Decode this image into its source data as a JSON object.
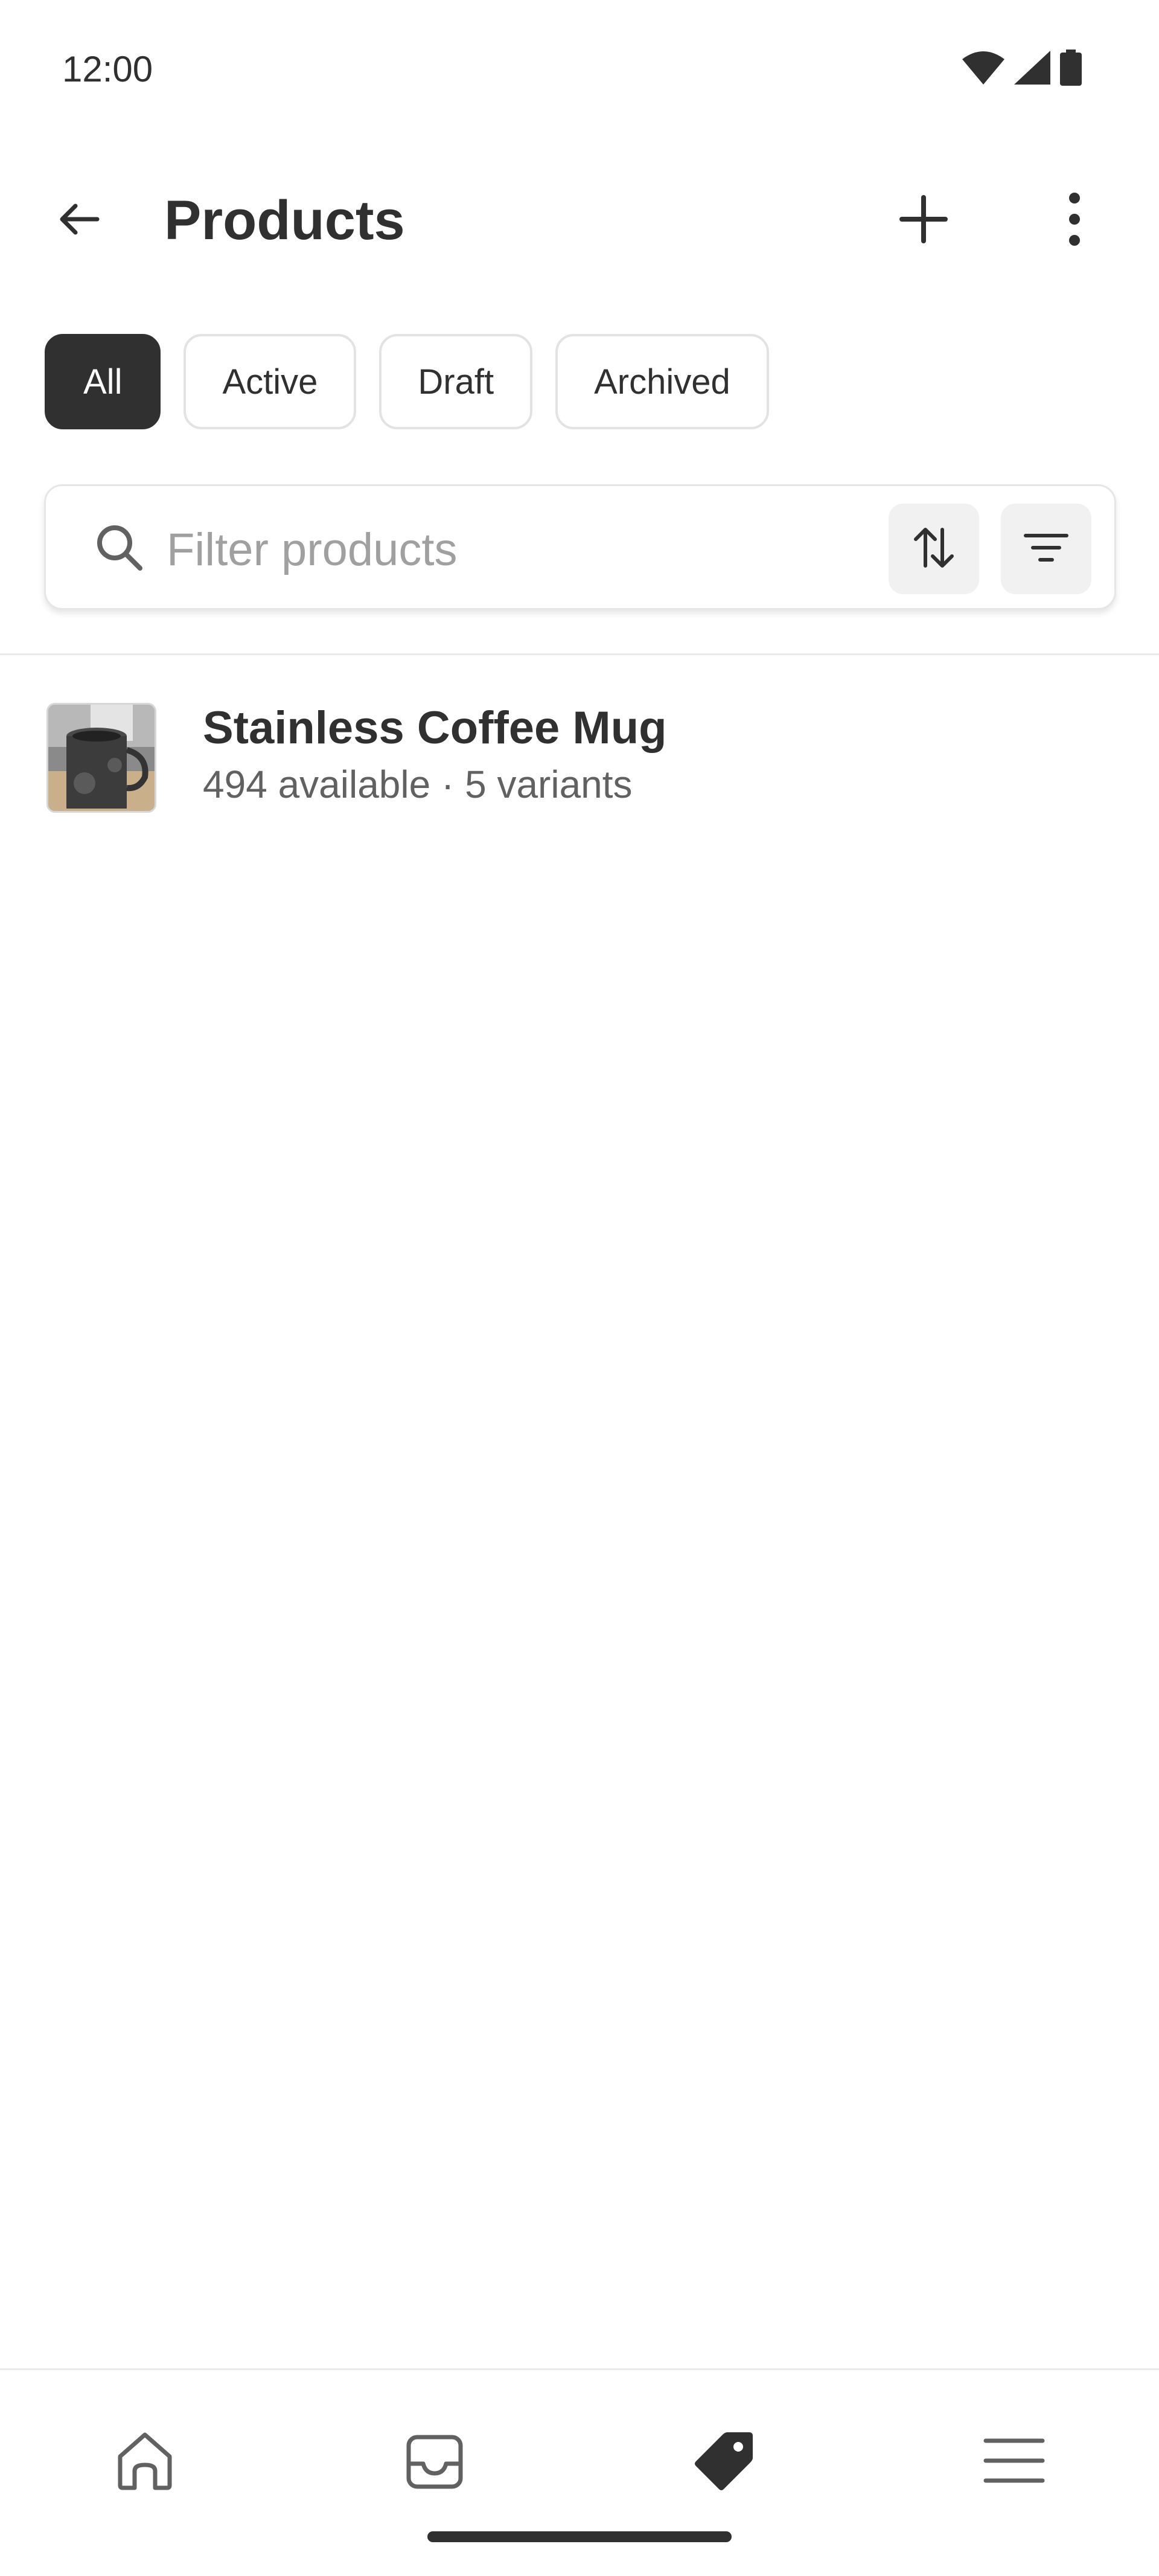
{
  "status_bar": {
    "time": "12:00",
    "icons": [
      "wifi-icon",
      "signal-icon",
      "battery-icon"
    ]
  },
  "header": {
    "title": "Products",
    "back_icon": "arrow-left-icon",
    "add_icon": "plus-icon",
    "more_icon": "more-vertical-icon"
  },
  "tabs": [
    {
      "label": "All",
      "selected": true
    },
    {
      "label": "Active",
      "selected": false
    },
    {
      "label": "Draft",
      "selected": false
    },
    {
      "label": "Archived",
      "selected": false
    }
  ],
  "search": {
    "placeholder": "Filter products",
    "value": "",
    "sort_icon": "sort-icon",
    "filter_icon": "filter-icon"
  },
  "products": [
    {
      "name": "Stainless Coffee Mug",
      "meta": "494 available · 5 variants",
      "thumbnail": "coffee-mug-image"
    }
  ],
  "bottom_nav": {
    "items": [
      {
        "icon": "home-icon",
        "active": false
      },
      {
        "icon": "inbox-icon",
        "active": false
      },
      {
        "icon": "tag-icon",
        "active": true
      },
      {
        "icon": "menu-icon",
        "active": false
      }
    ]
  },
  "colors": {
    "text_primary": "#303030",
    "text_secondary": "#616161",
    "chip_selected_bg": "#303030",
    "border": "#e3e3e3"
  }
}
